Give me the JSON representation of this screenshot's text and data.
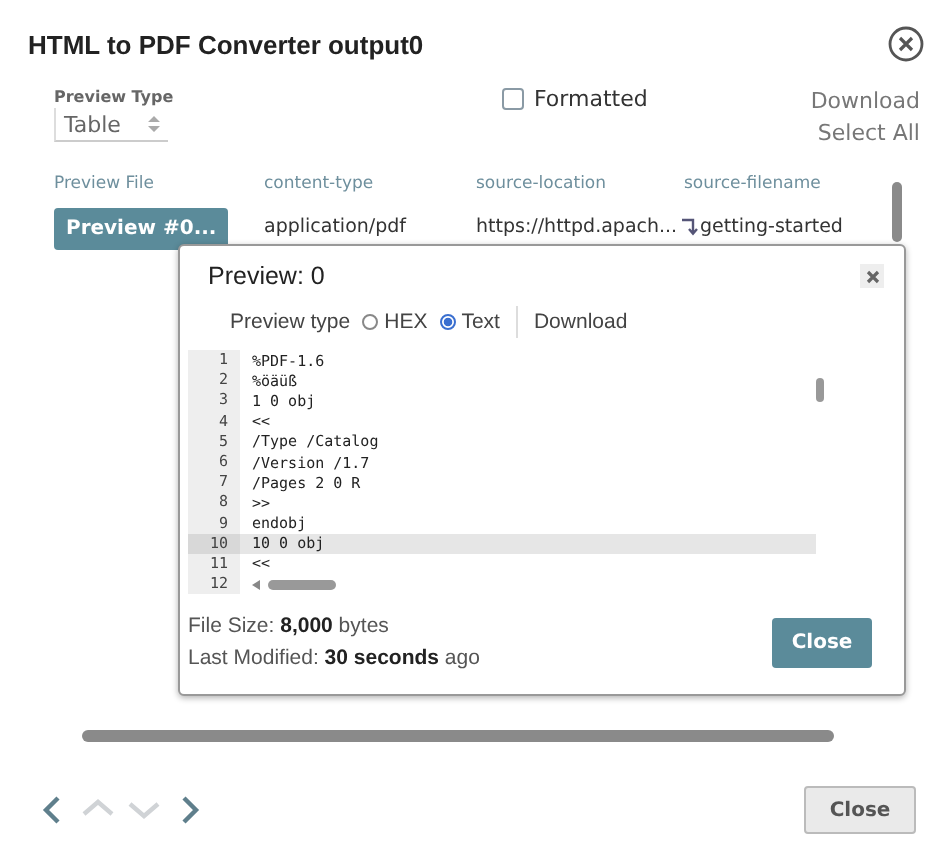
{
  "window": {
    "title": "HTML to PDF Converter output0"
  },
  "preview_type": {
    "label": "Preview Type",
    "value": "Table"
  },
  "formatted": {
    "label": "Formatted",
    "checked": false
  },
  "actions": [
    "Download",
    "Select All"
  ],
  "table": {
    "columns": [
      "Preview File",
      "content-type",
      "source-location",
      "source-filename"
    ],
    "rows": [
      {
        "cells": [
          "Preview #0...",
          "application/pdf",
          "https://httpd.apach...",
          "getting-started"
        ]
      }
    ]
  },
  "preview": {
    "title": "Preview: 0",
    "type_label": "Preview type",
    "options": [
      {
        "label": "HEX",
        "selected": false
      },
      {
        "label": "Text",
        "selected": true
      }
    ],
    "download": "Download",
    "lines": [
      {
        "number": "1",
        "text": "%PDF-1.6",
        "selected": false
      },
      {
        "number": "2",
        "text": "%öäüß",
        "selected": false
      },
      {
        "number": "3",
        "text": "1 0 obj",
        "selected": false
      },
      {
        "number": "4",
        "text": "<<",
        "selected": false
      },
      {
        "number": "5",
        "text": "/Type /Catalog",
        "selected": false
      },
      {
        "number": "6",
        "text": "/Version /1.7",
        "selected": false
      },
      {
        "number": "7",
        "text": "/Pages 2 0 R",
        "selected": false
      },
      {
        "number": "8",
        "text": ">>",
        "selected": false
      },
      {
        "number": "9",
        "text": "endobj",
        "selected": false
      },
      {
        "number": "10",
        "text": "10 0 obj",
        "selected": true
      },
      {
        "number": "11",
        "text": "<<",
        "selected": false
      },
      {
        "number": "12",
        "selected": false
      }
    ],
    "file_size": "File Size: **8,000** bytes",
    "last_modified": "Last Modified: **30 seconds** ago",
    "close": "Close"
  },
  "nav": [
    {
      "kind": "left",
      "disabled": false
    },
    {
      "kind": "up",
      "disabled": true
    },
    {
      "kind": "down",
      "disabled": true
    },
    {
      "kind": "right",
      "disabled": false
    }
  ],
  "close": "Close"
}
